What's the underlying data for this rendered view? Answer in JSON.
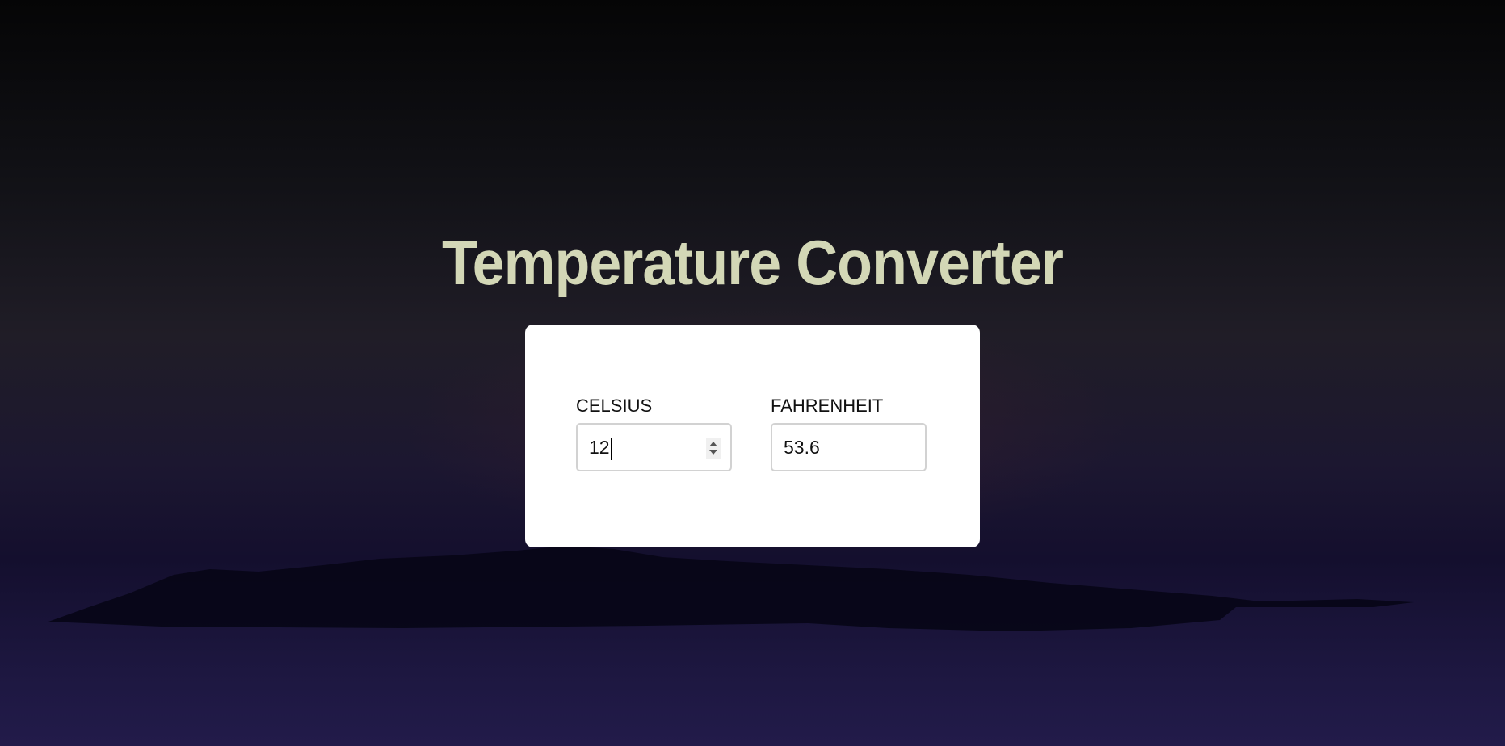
{
  "title": "Temperature Converter",
  "celsius": {
    "label": "CELSIUS",
    "value": "12"
  },
  "fahrenheit": {
    "label": "FAHRENHEIT",
    "value": "53.6"
  }
}
